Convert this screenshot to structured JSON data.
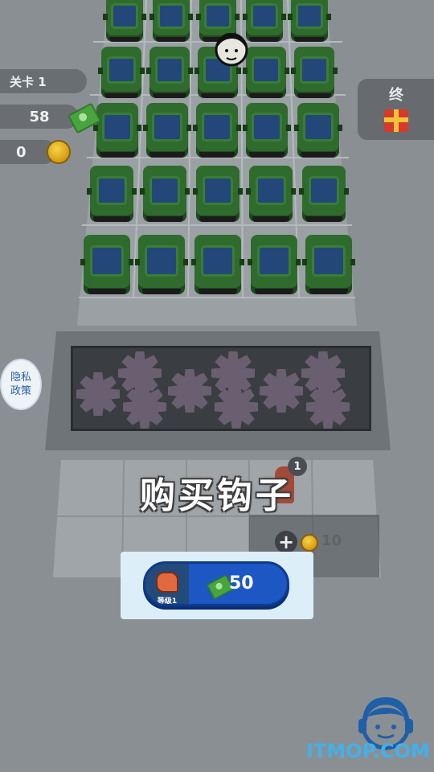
{
  "hud": {
    "level": "关卡 1",
    "cash": "58",
    "coins": "0",
    "goal_label": "终"
  },
  "privacy": {
    "line1": "隐私",
    "line2": "政策"
  },
  "crane_label": "购买钩子",
  "hook_badge": "1",
  "expand_slot": {
    "plus": "+",
    "price": "10"
  },
  "buy_button": {
    "level_label": "等级1",
    "price": "50"
  },
  "watermark": "ITMOP.COM",
  "icons": [
    "cash-icon",
    "coin-icon",
    "gift-icon",
    "face-icon",
    "hook-icon",
    "plus-icon",
    "support-agent-icon"
  ],
  "colors": {
    "car_body": "#2f6b2c",
    "car_roof": "#24477a",
    "button_blue": "#1c57c4",
    "watermark": "#43b0e8"
  }
}
